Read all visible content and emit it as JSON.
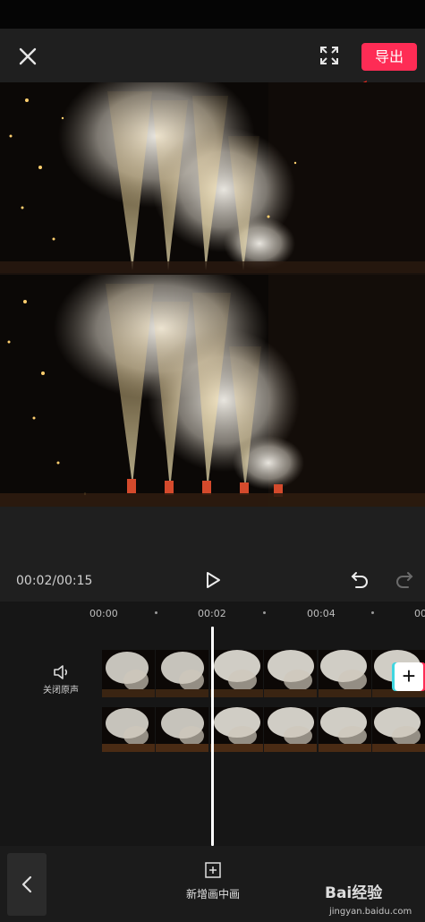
{
  "toolbar": {
    "export_label": "导出"
  },
  "player": {
    "time_readout": "00:02/00:15"
  },
  "timeline": {
    "ruler_labels": [
      "00:00",
      "00:02",
      "00:04",
      "00"
    ],
    "mute_label": "关闭原声",
    "add_clip_label": "+"
  },
  "bottom": {
    "add_pip_label": "新增画中画"
  },
  "watermark": {
    "logo_text": "Bai经验",
    "url_text": "jingyan.baidu.com"
  },
  "icons": {
    "close": "close-icon",
    "fullscreen": "fullscreen-icon",
    "play": "play-icon",
    "undo": "undo-icon",
    "redo": "redo-icon",
    "speaker": "speaker-icon",
    "add": "add-icon",
    "back": "chevron-left-icon"
  },
  "colors": {
    "export_button": "#fe2c55",
    "annotation_arrow": "#e8291f",
    "playhead": "#ffffff"
  }
}
